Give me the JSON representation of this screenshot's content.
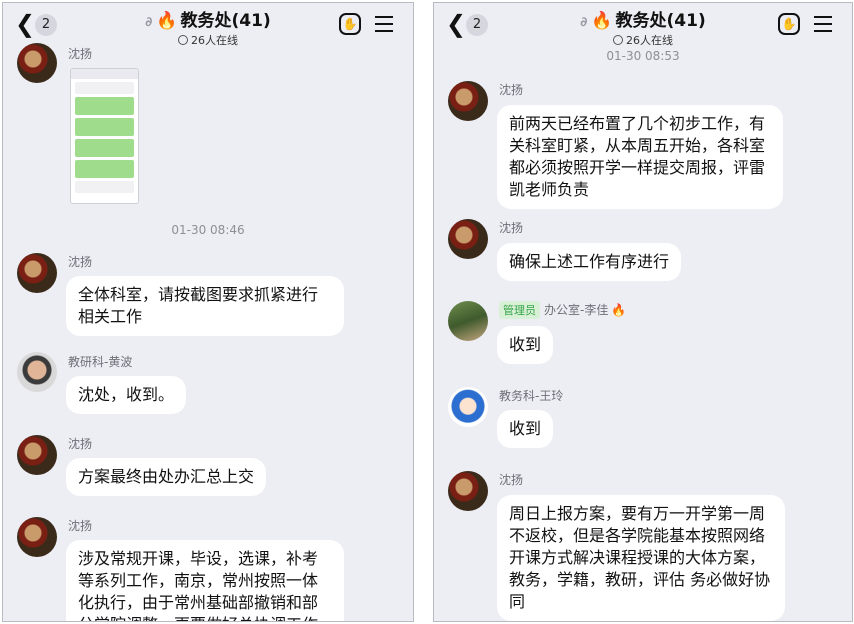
{
  "header": {
    "back_count": "2",
    "title": "教务处(41)",
    "online": "26人在线"
  },
  "left": {
    "messages": [
      {
        "sender": "沈扬"
      },
      {
        "time": "01-30 08:46"
      },
      {
        "sender": "沈扬",
        "text": "全体科室，请按截图要求抓紧进行相关工作"
      },
      {
        "sender": "教研科-黄波",
        "text": "沈处，收到。"
      },
      {
        "sender": "沈扬",
        "text": "方案最终由处办汇总上交"
      },
      {
        "sender": "沈扬",
        "text": "涉及常规开课，毕设，选课，补考等系列工作，南京，常州按照一体化执行，由于常州基础部撤销和部分学院调整，更要做好总协调工作"
      }
    ]
  },
  "right": {
    "messages": [
      {
        "time": "01-30 08:53"
      },
      {
        "sender": "沈扬",
        "text": "前两天已经布置了几个初步工作，有关科室盯紧，从本周五开始，各科室都必须按照开学一样提交周报，评雷凯老师负责"
      },
      {
        "sender": "沈扬",
        "text": "确保上述工作有序进行"
      },
      {
        "tag": "管理员",
        "sender": "办公室-李佳",
        "text": "收到"
      },
      {
        "sender": "教务科-王玲",
        "text": "收到"
      },
      {
        "sender": "沈扬",
        "text": "周日上报方案，要有万一开学第一周不返校，但是各学院能基本按照网络开课方式解决课程授课的大体方案，教务，学籍，教研，评估 务必做好协同"
      }
    ]
  }
}
